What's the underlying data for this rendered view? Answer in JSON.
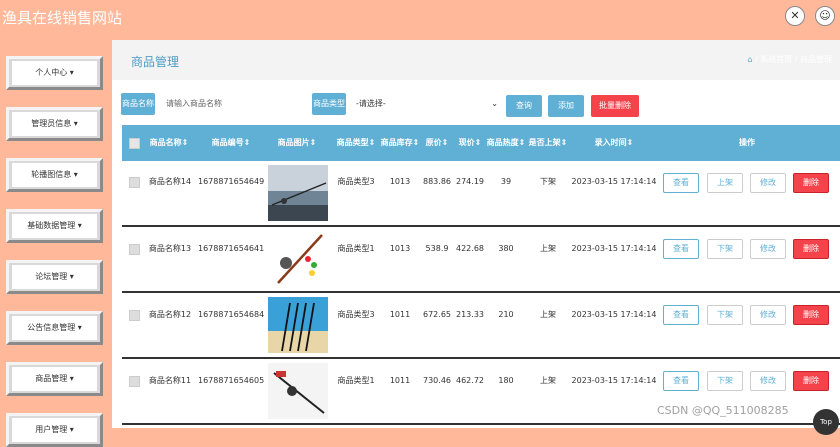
{
  "app": {
    "title": "渔具在线销售网站"
  },
  "topbar": {
    "close_icon": "close-icon",
    "user_icon": "user-icon"
  },
  "sidebar": {
    "items": [
      {
        "label": "个人中心 ▾"
      },
      {
        "label": "管理员信息 ▾"
      },
      {
        "label": "轮播图信息 ▾"
      },
      {
        "label": "基础数据管理 ▾"
      },
      {
        "label": "论坛管理 ▾"
      },
      {
        "label": "公告信息管理 ▾"
      },
      {
        "label": "商品管理 ▾"
      },
      {
        "label": "用户管理 ▾"
      }
    ]
  },
  "page": {
    "title": "商品管理",
    "breadcrumb": [
      "系统首页",
      "商品管理"
    ]
  },
  "search": {
    "name_label": "商品名称",
    "name_placeholder": "请输入商品名称",
    "type_label": "商品类型",
    "type_selected": "-请选择-",
    "query_btn": "查询",
    "add_btn": "添加",
    "batch_delete_btn": "批量删除"
  },
  "table": {
    "headers": [
      "商品名称⇕",
      "商品编号⇕",
      "商品图片⇕",
      "商品类型⇕",
      "商品库存⇕",
      "原价⇕",
      "现价⇕",
      "商品热度⇕",
      "是否上架⇕",
      "录入时间⇕",
      "操作"
    ],
    "rows": [
      {
        "name": "商品名称14",
        "code": "1678871654649",
        "type": "商品类型3",
        "stock": "1013",
        "orig": "883.86",
        "now": "274.19",
        "hot": "39",
        "status": "下架",
        "time": "2023-03-15 17:14:14",
        "toggle": "上架"
      },
      {
        "name": "商品名称13",
        "code": "1678871654641",
        "type": "商品类型1",
        "stock": "1013",
        "orig": "538.9",
        "now": "422.68",
        "hot": "380",
        "status": "上架",
        "time": "2023-03-15 17:14:14",
        "toggle": "下架"
      },
      {
        "name": "商品名称12",
        "code": "1678871654684",
        "type": "商品类型3",
        "stock": "1011",
        "orig": "672.65",
        "now": "213.33",
        "hot": "210",
        "status": "上架",
        "time": "2023-03-15 17:14:14",
        "toggle": "下架"
      },
      {
        "name": "商品名称11",
        "code": "1678871654605",
        "type": "商品类型1",
        "stock": "1011",
        "orig": "730.46",
        "now": "462.72",
        "hot": "180",
        "status": "上架",
        "time": "2023-03-15 17:14:14",
        "toggle": "下架"
      }
    ],
    "actions": {
      "view": "查看",
      "edit": "修改",
      "delete": "删除"
    }
  },
  "watermark": "CSDN @QQ_511008285",
  "top_button": "Top",
  "colors": {
    "accent": "#5fb0d4",
    "danger": "#f4434b",
    "frame": "#ffb89a"
  }
}
